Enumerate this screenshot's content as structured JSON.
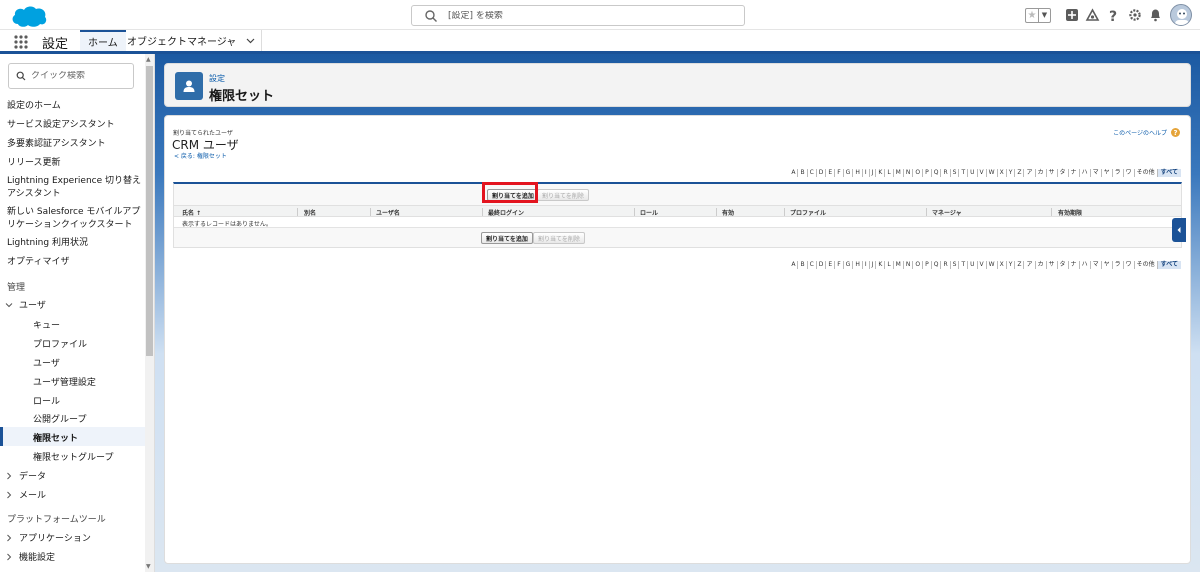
{
  "header": {
    "search_placeholder": "[設定] を検索",
    "colors": {
      "brand": "#1b5297",
      "link": "#0b5cab",
      "highlight": "#e3141f"
    }
  },
  "nav": {
    "app_name": "設定",
    "tabs": [
      {
        "label": "ホーム"
      },
      {
        "label": "オブジェクトマネージャ"
      }
    ]
  },
  "sidebar": {
    "quick_find_placeholder": "クイック検索",
    "items": [
      "設定のホーム",
      "サービス設定アシスタント",
      "多要素認証アシスタント",
      "リリース更新",
      "Lightning Experience 切り替えアシスタント",
      "新しい Salesforce モバイルアプリケーションクイックスタート",
      "Lightning 利用状況",
      "オプティマイザ"
    ],
    "section_admin": "管理",
    "group_users": "ユーザ",
    "user_subitems": [
      "キュー",
      "プロファイル",
      "ユーザ",
      "ユーザ管理設定",
      "ロール",
      "公開グループ",
      "権限セット",
      "権限セットグループ"
    ],
    "group_data": "データ",
    "group_mail": "メール",
    "section_platform": "プラットフォームツール",
    "group_apps": "アプリケーション",
    "group_features": "機能設定"
  },
  "page_header": {
    "breadcrumb": "設定",
    "title": "権限セット"
  },
  "detail": {
    "label": "割り当てられたユーザ",
    "title": "CRM ユーザ",
    "back_link": "< 戻る: 権限セット",
    "help_link": "このページのヘルプ",
    "alphabet": [
      "A",
      "B",
      "C",
      "D",
      "E",
      "F",
      "G",
      "H",
      "I",
      "J",
      "K",
      "L",
      "M",
      "N",
      "O",
      "P",
      "Q",
      "R",
      "S",
      "T",
      "U",
      "V",
      "W",
      "X",
      "Y",
      "Z",
      "ア",
      "カ",
      "サ",
      "タ",
      "ナ",
      "ハ",
      "マ",
      "ヤ",
      "ラ",
      "ワ",
      "その他",
      "すべて"
    ],
    "add_button": "割り当てを追加",
    "remove_button": "割り当てを削除",
    "columns": [
      "氏名 ↑",
      "別名",
      "ユーザ名",
      "最終ログイン",
      "ロール",
      "有効",
      "プロファイル",
      "マネージャ",
      "有効期限"
    ],
    "empty_message": "表示するレコードはありません。"
  }
}
